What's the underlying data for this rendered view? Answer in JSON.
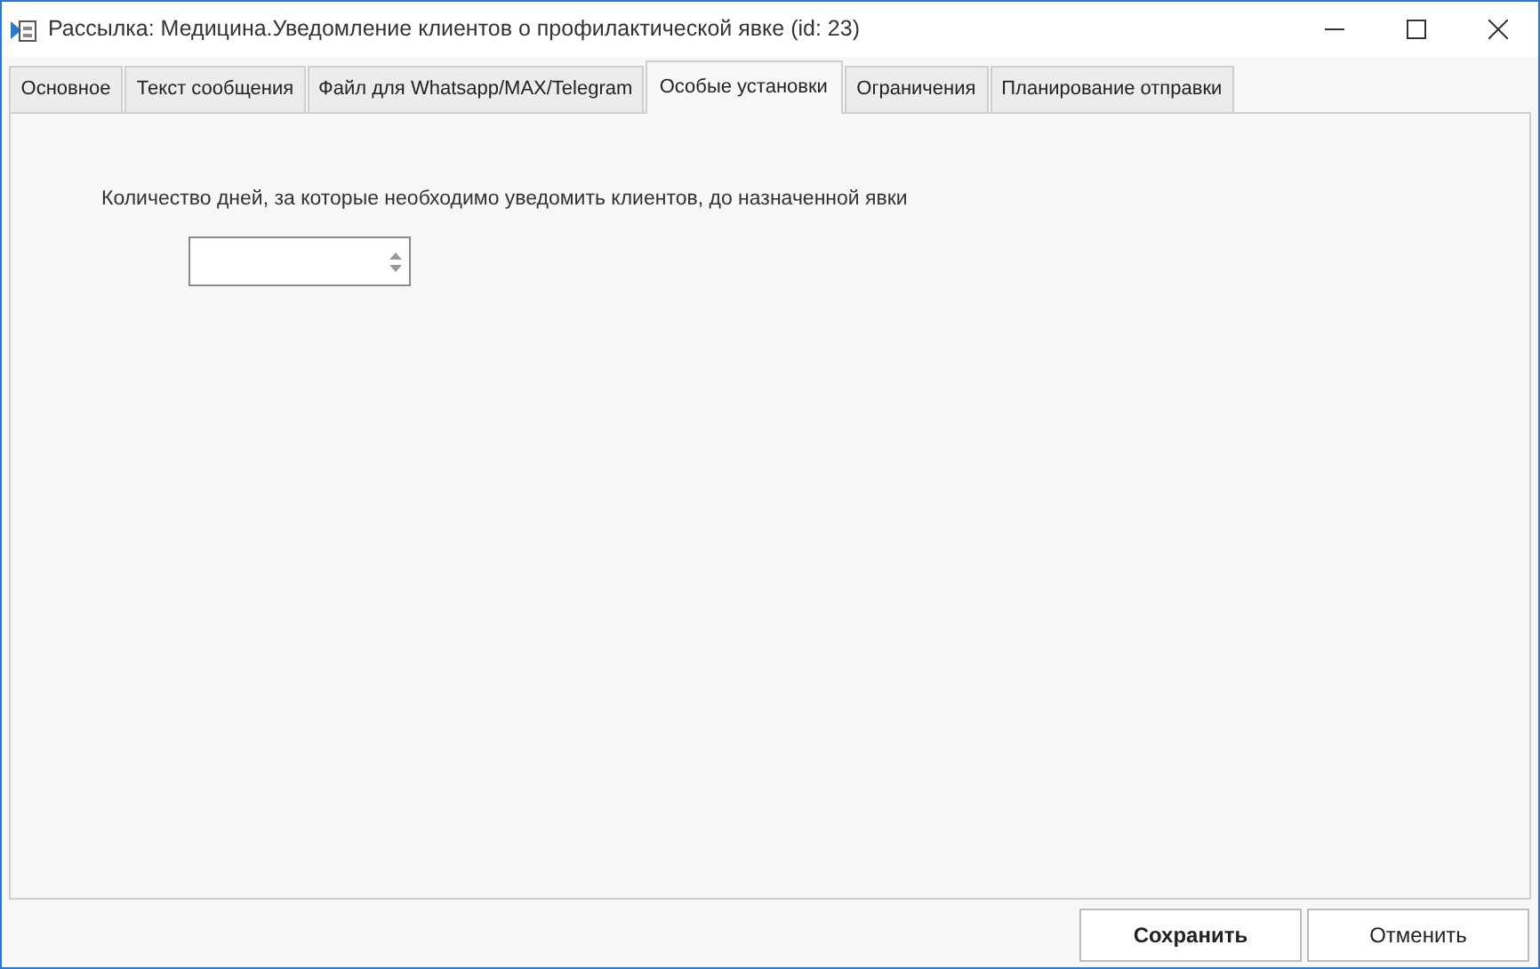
{
  "window": {
    "title": "Рассылка: Медицина.Уведомление клиентов о профилактической явке (id: 23)"
  },
  "tabs": [
    {
      "label": "Основное",
      "selected": false
    },
    {
      "label": "Текст сообщения",
      "selected": false
    },
    {
      "label": "Файл для Whatsapp/MAX/Telegram",
      "selected": false
    },
    {
      "label": "Особые установки",
      "selected": true
    },
    {
      "label": "Ограничения",
      "selected": false
    },
    {
      "label": "Планирование отправки",
      "selected": false
    }
  ],
  "days_field": {
    "label": "Количество дней, за которые необходимо уведомить клиентов, до назначенной явки"
  },
  "buttons": [
    {
      "label": "Сохранить",
      "kind": "primary"
    },
    {
      "label": "Отменить",
      "kind": "secondary"
    }
  ]
}
